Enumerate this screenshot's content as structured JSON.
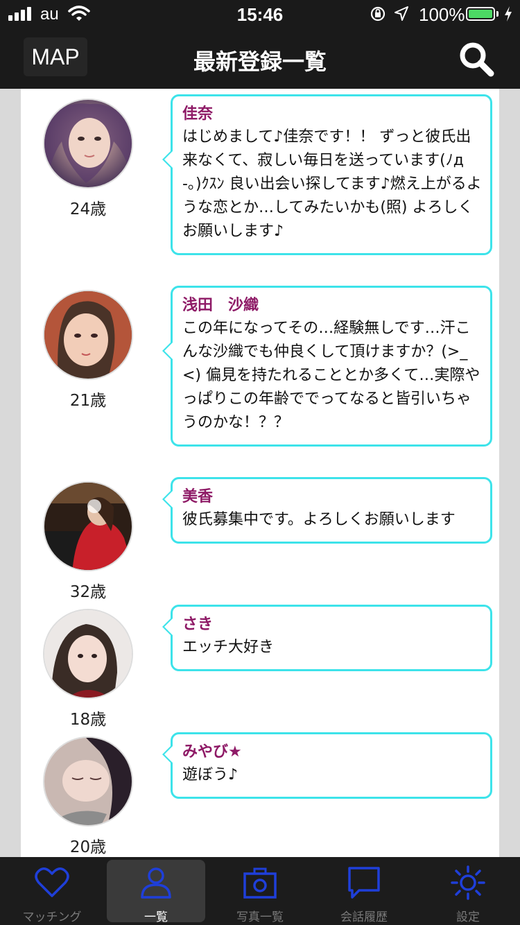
{
  "status_bar": {
    "carrier": "au",
    "time": "15:46",
    "battery_percent": "100%",
    "battery_level": 1.0,
    "battery_color": "#4cd964"
  },
  "header": {
    "map_label": "MAP",
    "title": "最新登録一覧",
    "search_icon": "search-icon"
  },
  "colors": {
    "bubble_border": "#3de3ea",
    "name_text": "#8e1a66",
    "tab_icon": "#1f3fd9"
  },
  "profiles": [
    {
      "name": "佳奈",
      "age": "24歳",
      "message": "はじめまして♪佳奈です！！ ずっと彼氏出来なくて、寂しい毎日を送っています(ﾉд-｡)ｸｽﾝ 良い出会い探してます♪燃え上がるような恋とか…してみたいかも(照) よろしくお願いします♪"
    },
    {
      "name": "浅田　沙織",
      "age": "21歳",
      "message": "この年になってその…経験無しです…汗こんな沙織でも仲良くして頂けますか？(>_<) 偏見を持たれることとか多くて…実際やっぱりこの年齢ででってなると皆引いちゃうのかな！？？"
    },
    {
      "name": "美香",
      "age": "32歳",
      "message": "彼氏募集中です。よろしくお願いします"
    },
    {
      "name": "さき",
      "age": "18歳",
      "message": "エッチ大好き"
    },
    {
      "name": "みやび★",
      "age": "20歳",
      "message": "遊ぼう♪"
    }
  ],
  "tabs": [
    {
      "label": "マッチング",
      "icon": "heart-icon",
      "active": false
    },
    {
      "label": "一覧",
      "icon": "person-icon",
      "active": true
    },
    {
      "label": "写真一覧",
      "icon": "camera-icon",
      "active": false
    },
    {
      "label": "会話履歴",
      "icon": "chat-bubble-icon",
      "active": false
    },
    {
      "label": "設定",
      "icon": "sun-gear-icon",
      "active": false
    }
  ]
}
